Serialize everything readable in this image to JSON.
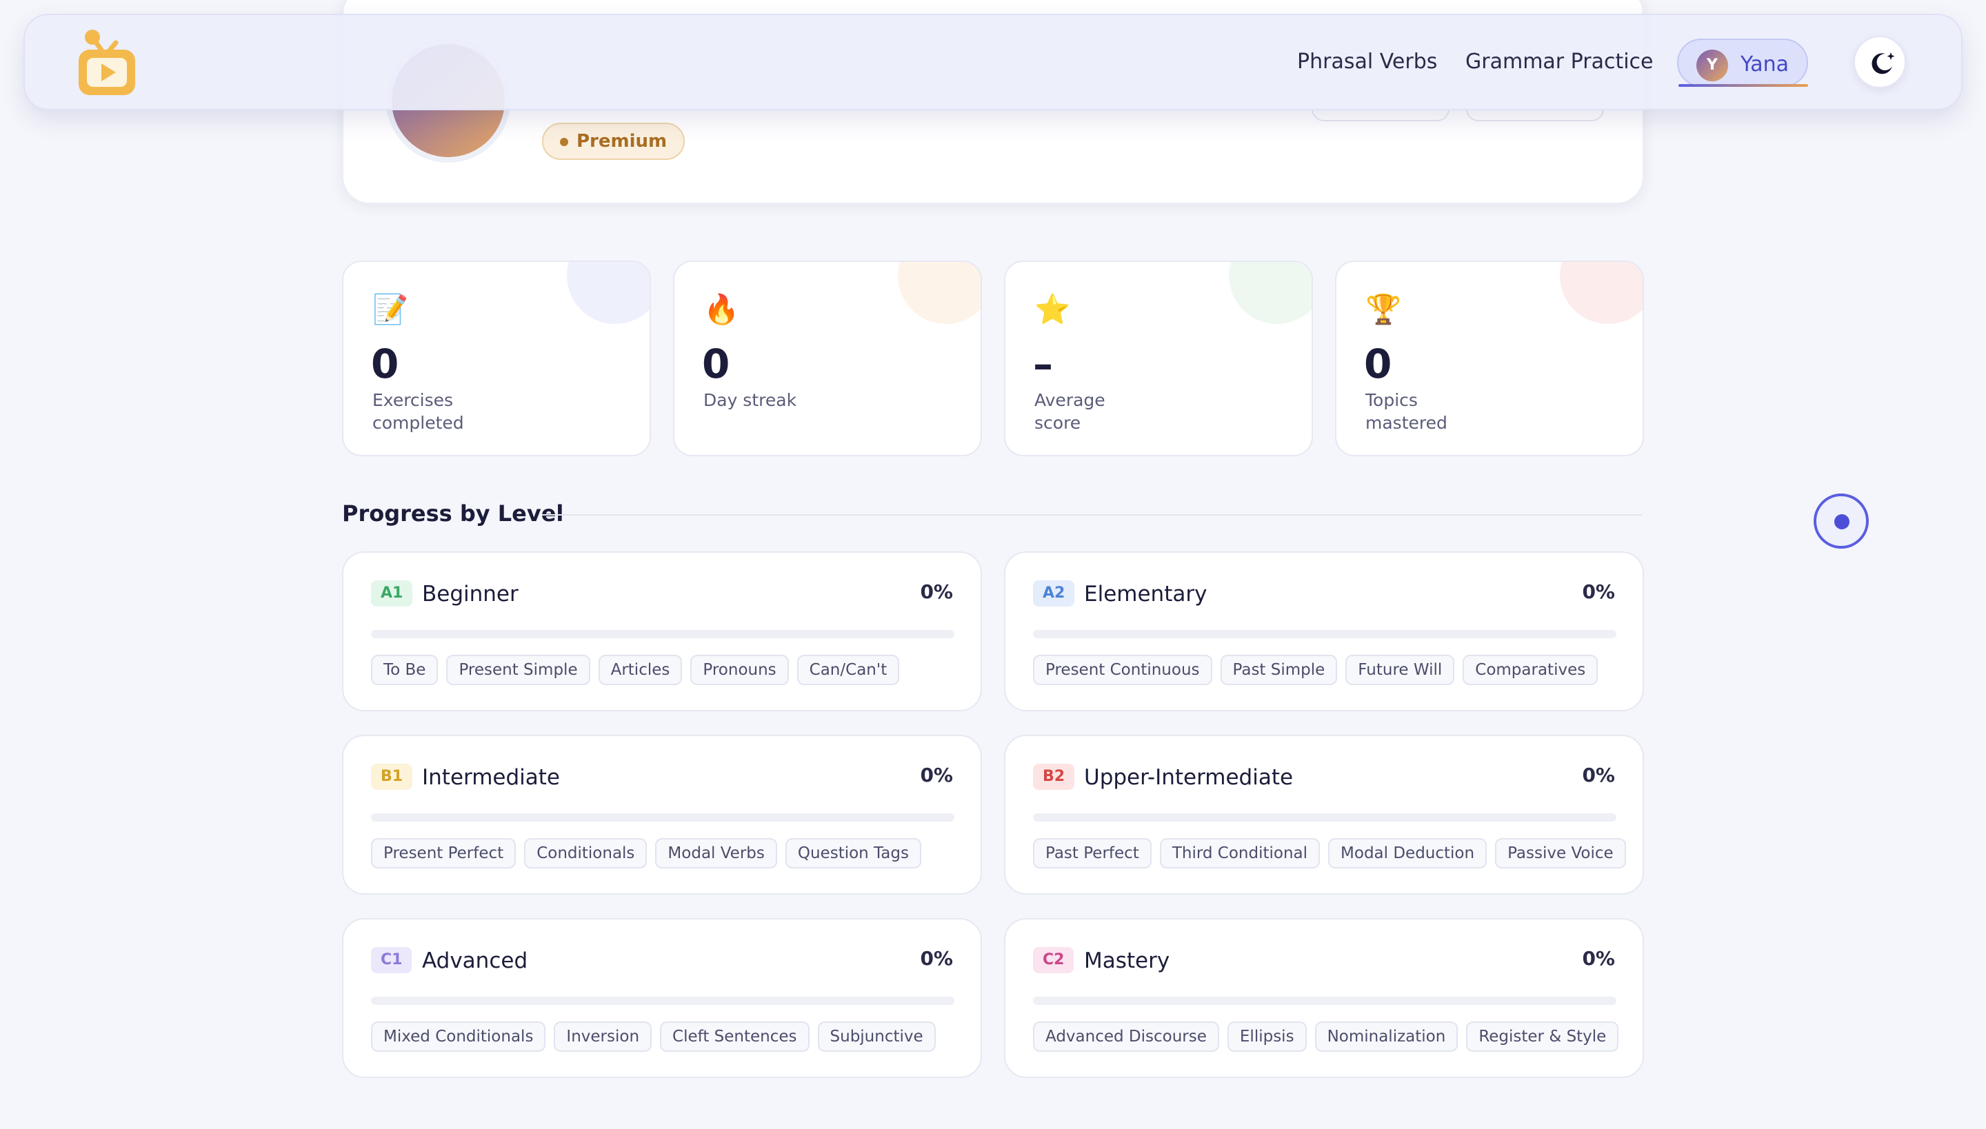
{
  "nav": {
    "links": [
      "Phrasal Verbs",
      "Grammar Practice"
    ],
    "user": {
      "initial": "Y",
      "name": "Yana"
    }
  },
  "profile": {
    "badge": "Premium"
  },
  "stats": [
    {
      "icon": "📝",
      "icon_name": "memo-icon",
      "value": "0",
      "label": "Exercises completed"
    },
    {
      "icon": "🔥",
      "icon_name": "fire-icon",
      "value": "0",
      "label": "Day streak"
    },
    {
      "icon": "⭐",
      "icon_name": "star-icon",
      "value": "–",
      "label": "Average score"
    },
    {
      "icon": "🏆",
      "icon_name": "trophy-icon",
      "value": "0",
      "label": "Topics mastered"
    }
  ],
  "progress": {
    "title": "Progress by Level",
    "levels": [
      {
        "code": "A1",
        "name": "Beginner",
        "percent": "0%",
        "progress": 0,
        "badge_bg": "#e3f6ea",
        "badge_fg": "#3aa866",
        "topics": [
          "To Be",
          "Present Simple",
          "Articles",
          "Pronouns",
          "Can/Can't"
        ]
      },
      {
        "code": "A2",
        "name": "Elementary",
        "percent": "0%",
        "progress": 0,
        "badge_bg": "#e3edfb",
        "badge_fg": "#4d82d6",
        "topics": [
          "Present Continuous",
          "Past Simple",
          "Future Will",
          "Comparatives"
        ]
      },
      {
        "code": "B1",
        "name": "Intermediate",
        "percent": "0%",
        "progress": 0,
        "badge_bg": "#fdf3d8",
        "badge_fg": "#d4a126",
        "topics": [
          "Present Perfect",
          "Conditionals",
          "Modal Verbs",
          "Question Tags"
        ]
      },
      {
        "code": "B2",
        "name": "Upper-Intermediate",
        "percent": "0%",
        "progress": 0,
        "badge_bg": "#fde4e4",
        "badge_fg": "#d64545",
        "topics": [
          "Past Perfect",
          "Third Conditional",
          "Modal Deduction",
          "Passive Voice"
        ]
      },
      {
        "code": "C1",
        "name": "Advanced",
        "percent": "0%",
        "progress": 0,
        "badge_bg": "#ece8fb",
        "badge_fg": "#8c7ad8",
        "topics": [
          "Mixed Conditionals",
          "Inversion",
          "Cleft Sentences",
          "Subjunctive"
        ]
      },
      {
        "code": "C2",
        "name": "Mastery",
        "percent": "0%",
        "progress": 0,
        "badge_bg": "#fbe3ef",
        "badge_fg": "#c9478a",
        "topics": [
          "Advanced Discourse",
          "Ellipsis",
          "Nominalization",
          "Register & Style"
        ]
      }
    ]
  },
  "colors": {
    "accent": "#5b5fe0",
    "premium": "#a86e22"
  }
}
